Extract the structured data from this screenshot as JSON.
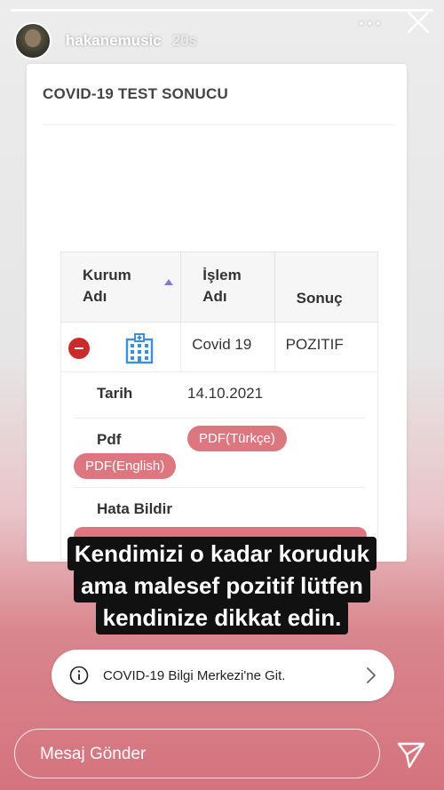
{
  "story": {
    "progress": 1.0,
    "username": "hakanemusic",
    "time": "20s",
    "more_label": "···",
    "close_icon": "close-icon",
    "avatar_icon": "avatar"
  },
  "document": {
    "title": "COVID-19 TEST SONUCU",
    "table": {
      "headers": [
        "Kurum Adı",
        "İşlem Adı",
        "Sonuç"
      ],
      "row": {
        "procedure": "Covid 19",
        "result": "POZITIF"
      }
    },
    "details": {
      "date_label": "Tarih",
      "date_value": "14.10.2021",
      "pdf_label": "Pdf",
      "pdf_tr": "PDF(Türkçe)",
      "pdf_en": "PDF(English)",
      "error_label": "Hata Bildir"
    }
  },
  "caption": {
    "lines": [
      "Kendimizi o kadar koruduk",
      "ama malesef pozitif lütfen",
      "kendinize dikkat edin."
    ]
  },
  "link_sticker": {
    "label": "COVID-19 Bilgi Merkezi'ne Git."
  },
  "message_bar": {
    "placeholder": "Mesaj Gönder"
  },
  "colors": {
    "pill": "#dc7780",
    "minus": "#cc2b2b",
    "hospital": "#3f8ed8",
    "sort": "#7d7dd8"
  }
}
